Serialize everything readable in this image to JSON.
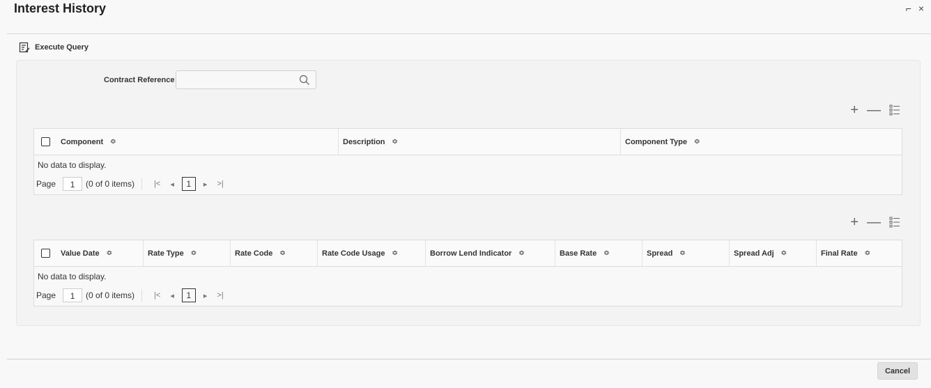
{
  "window": {
    "title": "Interest History",
    "restore_glyph": "⌐",
    "close_glyph": "×"
  },
  "toolbar": {
    "execute_query_label": "Execute Query"
  },
  "form": {
    "contract_reference_label": "Contract Reference",
    "contract_reference_value": "",
    "contract_reference_placeholder": ""
  },
  "grid_actions": {
    "add": "+",
    "remove": "—"
  },
  "component_grid": {
    "columns": [
      "Component",
      "Description",
      "Component Type"
    ],
    "empty_text": "No data to display.",
    "pager": {
      "label": "Page",
      "page": "1",
      "items": "(0 of 0 items)",
      "current": "1"
    }
  },
  "rate_grid": {
    "columns": [
      "Value Date",
      "Rate Type",
      "Rate Code",
      "Rate Code Usage",
      "Borrow Lend Indicator",
      "Base Rate",
      "Spread",
      "Spread Adj",
      "Final Rate"
    ],
    "empty_text": "No data to display.",
    "pager": {
      "label": "Page",
      "page": "1",
      "items": "(0 of 0 items)",
      "current": "1"
    }
  },
  "footer": {
    "cancel_label": "Cancel"
  },
  "icons": {
    "execute_query": "execute-query-icon",
    "search": "search-icon",
    "add": "plus-icon",
    "remove": "minus-icon",
    "columns": "column-settings-icon",
    "sort": "sort-icon",
    "first": "first-page-icon",
    "prev": "prev-page-icon",
    "next": "next-page-icon",
    "last": "last-page-icon"
  }
}
